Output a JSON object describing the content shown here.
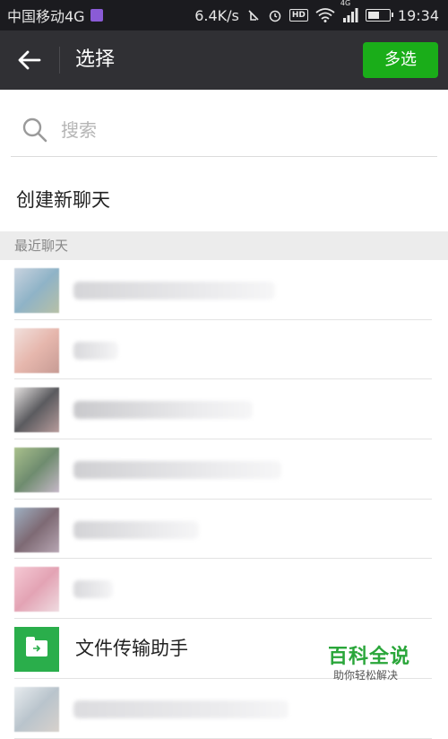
{
  "status_bar": {
    "carrier": "中国移动4G",
    "net_speed": "6.4K/s",
    "hd_label": "HD",
    "signal_type": "4G",
    "time": "19:34",
    "battery_level": 0.6
  },
  "header": {
    "title": "选择",
    "multi_select_label": "多选",
    "accent_color": "#1aad19"
  },
  "search": {
    "placeholder": "搜索"
  },
  "new_chat_label": "创建新聊天",
  "section_header": "最近聊天",
  "chats": [
    {
      "name": "",
      "avatar_colors": [
        "#c9d3df",
        "#8fb3c7",
        "#b7c0a6"
      ],
      "name_blur": "#d5d5d8",
      "blur_width": 225
    },
    {
      "name": "",
      "avatar_colors": [
        "#f1e0dc",
        "#e6b7ad",
        "#c79b94"
      ],
      "name_blur": "#d9d9dc",
      "blur_width": 50
    },
    {
      "name": "",
      "avatar_colors": [
        "#e5e2e1",
        "#5b5b5f",
        "#b79c9c"
      ],
      "name_blur": "#c9c9cc",
      "blur_width": 200
    },
    {
      "name": "",
      "avatar_colors": [
        "#a9c08c",
        "#6f8c6f",
        "#c6b8c8"
      ],
      "name_blur": "#cfcfd2",
      "blur_width": 232
    },
    {
      "name": "",
      "avatar_colors": [
        "#9fb0c2",
        "#7e6a74",
        "#b7a6b3"
      ],
      "name_blur": "#d3d3d6",
      "blur_width": 140
    },
    {
      "name": "",
      "avatar_colors": [
        "#f5c9d4",
        "#e3a3b4",
        "#efdbe0"
      ],
      "name_blur": "#d9d9dc",
      "blur_width": 44
    },
    {
      "name": "文件传输助手",
      "icon": "file-transfer-icon",
      "avatar_color": "#2aae4b"
    },
    {
      "name": "",
      "avatar_colors": [
        "#e8ecef",
        "#b9c4cc",
        "#d7d1cc"
      ],
      "name_blur": "#dcdcdf",
      "blur_width": 240
    }
  ],
  "watermark": {
    "title": "百科全说",
    "subtitle": "助你轻松解决"
  }
}
